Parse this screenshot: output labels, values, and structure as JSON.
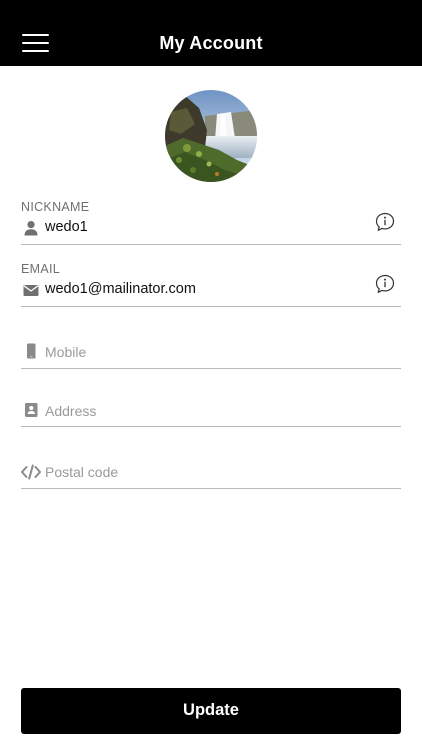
{
  "header": {
    "title": "My Account",
    "menu_icon": "hamburger-menu-icon"
  },
  "profile": {
    "avatar_icon": "profile-photo-waterfall"
  },
  "fields": {
    "nickname": {
      "label": "NICKNAME",
      "value": "wedo1",
      "icon": "person-icon",
      "info_icon": "info-bubble-icon"
    },
    "email": {
      "label": "EMAIL",
      "value": "wedo1@mailinator.com",
      "icon": "envelope-icon",
      "info_icon": "info-bubble-icon"
    },
    "mobile": {
      "placeholder": "Mobile",
      "icon": "phone-icon"
    },
    "address": {
      "placeholder": "Address",
      "icon": "address-book-icon"
    },
    "postal": {
      "placeholder": "Postal code",
      "icon": "code-icon"
    }
  },
  "actions": {
    "update_label": "Update"
  },
  "colors": {
    "header_bg": "#000000",
    "button_bg": "#000000",
    "divider": "#b9b9b9",
    "label": "#707070",
    "placeholder": "#9a9a9a"
  }
}
